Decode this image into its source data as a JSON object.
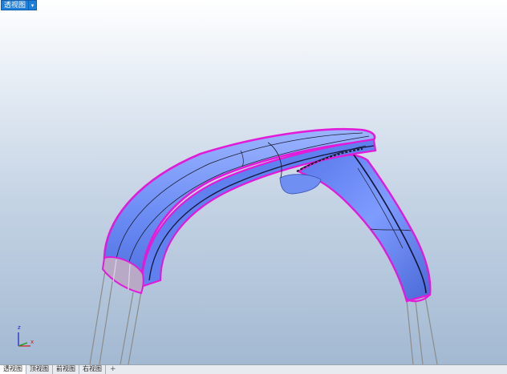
{
  "viewport": {
    "title": "透视图",
    "dropdown_glyph": "▾",
    "axis_labels": {
      "z": "z",
      "x": "x"
    },
    "colors": {
      "surface": "#6e8ff5",
      "selection_edge": "#e21bd8",
      "isocurve": "#1a1a2e",
      "cut_face": "#b8a9c6"
    }
  },
  "tabs": {
    "items": [
      "透视图",
      "顶视图",
      "前视图",
      "右视图"
    ],
    "add_glyph": "+"
  }
}
